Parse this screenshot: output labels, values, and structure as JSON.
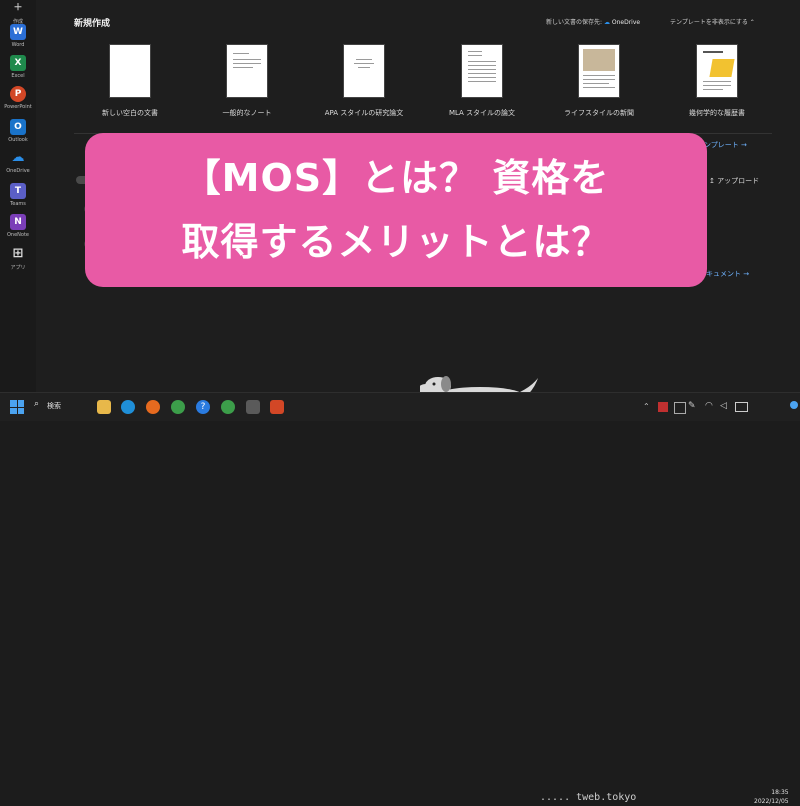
{
  "rail": {
    "create_label": "作成",
    "apps": [
      {
        "name": "Word",
        "color": "#2b6fd6",
        "glyph": "W"
      },
      {
        "name": "Excel",
        "color": "#1f8a4c",
        "glyph": "X"
      },
      {
        "name": "PowerPoint",
        "color": "#d24726",
        "glyph": "P"
      },
      {
        "name": "Outlook",
        "color": "#1a73c9",
        "glyph": "O"
      },
      {
        "name": "OneDrive",
        "color": "#2a8ee8",
        "glyph": "☁"
      },
      {
        "name": "Teams",
        "color": "#5b5fc7",
        "glyph": "T"
      },
      {
        "name": "OneNote",
        "color": "#7b3fb8",
        "glyph": "N"
      },
      {
        "name": "アプリ",
        "color": "#3a3a3a",
        "glyph": "⊞"
      }
    ]
  },
  "section": {
    "title": "新規作成",
    "save_location_label": "新しい文書の保存先:",
    "save_location_value": "OneDrive",
    "hide_templates": "テンプレートを非表示にする ⌃"
  },
  "templates": [
    {
      "caption": "新しい空白の文書"
    },
    {
      "caption": "一般的なノート"
    },
    {
      "caption": "APA スタイルの研究論文"
    },
    {
      "caption": "MLA スタイルの論文"
    },
    {
      "caption": "ライフスタイルの新聞"
    },
    {
      "caption": "幾何学的な履歴書"
    }
  ],
  "right": {
    "more_templates": "ンプレート →",
    "upload": "アップロード",
    "documents": "キュメント →"
  },
  "banner": {
    "line1": "【MOS】とは？ 資格を",
    "line2": "取得するメリットとは？"
  },
  "taskbar": {
    "search": "検索",
    "site": "..... tweb.tokyo",
    "time": "18:35",
    "date": "2022/12/05"
  }
}
